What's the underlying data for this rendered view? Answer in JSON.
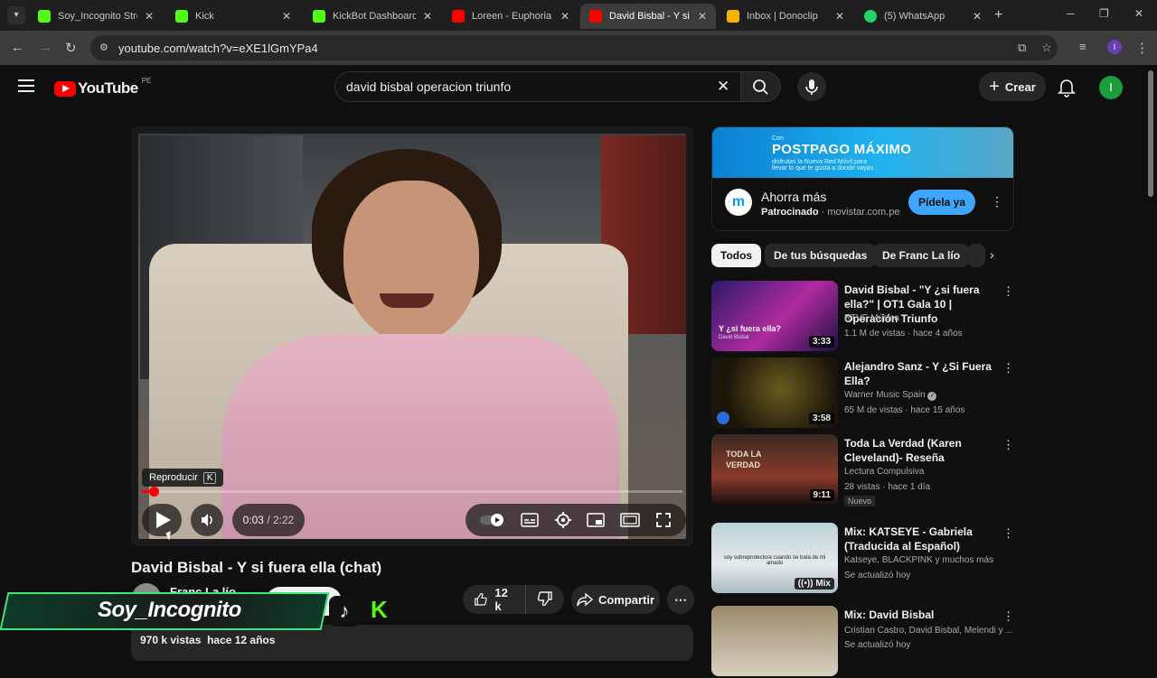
{
  "browser": {
    "tabs": [
      {
        "title": "Soy_Incognito Stream",
        "color": "#53fc18"
      },
      {
        "title": "Kick",
        "color": "#53fc18"
      },
      {
        "title": "KickBot Dashboard",
        "color": "#53fc18"
      },
      {
        "title": "Loreen - Euphoria | S",
        "color": "#ff0000"
      },
      {
        "title": "David Bisbal - Y si fue",
        "color": "#ff0000",
        "active": true
      },
      {
        "title": "Inbox | Donoclip",
        "color": "#f5b400"
      },
      {
        "title": "(5) WhatsApp",
        "color": "#25d366"
      }
    ],
    "url": "youtube.com/watch?v=eXE1lGmYPa4",
    "profile_initial": "I"
  },
  "header": {
    "logo_text": "YouTube",
    "country_code": "PE",
    "search_query": "david bisbal operacion triunfo",
    "create_label": "Crear",
    "avatar_initial": "I"
  },
  "player": {
    "tooltip_label": "Reproducir",
    "tooltip_key": "K",
    "current_time": "0:03",
    "duration": "2:22",
    "progress": 0.021
  },
  "video": {
    "title": "David Bisbal - Y si fuera ella (chat)",
    "channel": "Franc La lío",
    "likes": "12 k",
    "share_label": "Compartir",
    "views": "970 k vistas",
    "age": "hace 12 años"
  },
  "overlay": {
    "streamer_name": "Soy_Incognito"
  },
  "ad": {
    "banner_small": "Con",
    "banner_brand": "POSTPAGO MÁXIMO",
    "banner_sub": "disfrutas la Nueva Red Móvil para llevar lo que te gusta a donde vayas.",
    "title": "Ahorra más",
    "sponsored_label": "Patrocinado",
    "domain": "movistar.com.pe",
    "cta": "Pídela ya"
  },
  "chips": [
    "Todos",
    "De tus búsquedas",
    "De Franc La lío"
  ],
  "recommendations": [
    {
      "title": "David Bisbal - \"Y ¿si fuera ella?\" | OT1 Gala 10 | Operación Triunfo",
      "channel": "RTVE Música",
      "stats": "1.1 M de vistas · hace 4 años",
      "duration": "3:33",
      "thumb_text": "Y ¿si fuera ella?",
      "thumb_sub": "David Bisbal"
    },
    {
      "title": "Alejandro Sanz - Y ¿Si Fuera Ella?",
      "channel": "Warner Music Spain",
      "stats": "65 M de vistas · hace 15 años",
      "duration": "3:58"
    },
    {
      "title": "Toda La Verdad (Karen Cleveland)- Reseña",
      "channel": "Lectura Compulsiva",
      "stats": "28 vistas · hace 1 día",
      "duration": "9:11",
      "badge": "Nuevo",
      "thumb_text": "TODA LA VERDAD"
    },
    {
      "title": "Mix: KATSEYE - Gabriela (Traducida al Español)",
      "channel": "Katseye, BLACKPINK y muchos más",
      "stats": "Se actualizó hoy",
      "duration": "Mix",
      "thumb_text": "soy sobreprotectora cuando se trata de mi amado"
    },
    {
      "title": "Mix: David Bisbal",
      "channel": "Cristian Castro, David Bisbal, Melendi y ...",
      "stats": "Se actualizó hoy"
    }
  ]
}
